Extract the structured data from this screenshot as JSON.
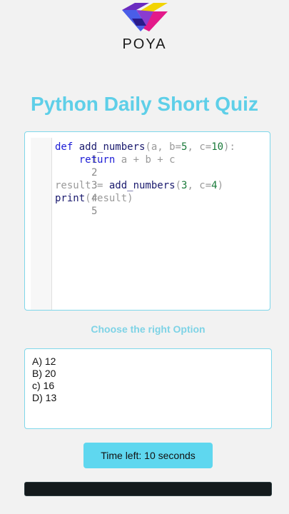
{
  "logo": {
    "text": "POYA",
    "colors": [
      "#6a2bc0",
      "#f2d400",
      "#4a5ee8",
      "#e3198a"
    ]
  },
  "title": "Python Daily Short Quiz",
  "code": {
    "lines": [
      {
        "num": "1",
        "text": "def add_numbers(a, b=5, c=10):"
      },
      {
        "num": "2",
        "text": "    return a + b + c"
      },
      {
        "num": "3",
        "text": ""
      },
      {
        "num": "4",
        "text": "result = add_numbers(3, c=4)"
      },
      {
        "num": "5",
        "text": "print(result)"
      }
    ]
  },
  "subtitle": "Choose the right Option",
  "options": [
    {
      "label": "A) 12"
    },
    {
      "label": "B) 20"
    },
    {
      "label": "c) 16"
    },
    {
      "label": "D) 13"
    }
  ],
  "timer": {
    "label": "Time left: 10 seconds",
    "seconds": 10
  },
  "progress": {
    "fraction": 0
  },
  "colors": {
    "accent": "#5ecfe8",
    "timer_bg": "#5fd7ef",
    "border": "#7fd7ea",
    "progress_bg": "#141a1c"
  }
}
